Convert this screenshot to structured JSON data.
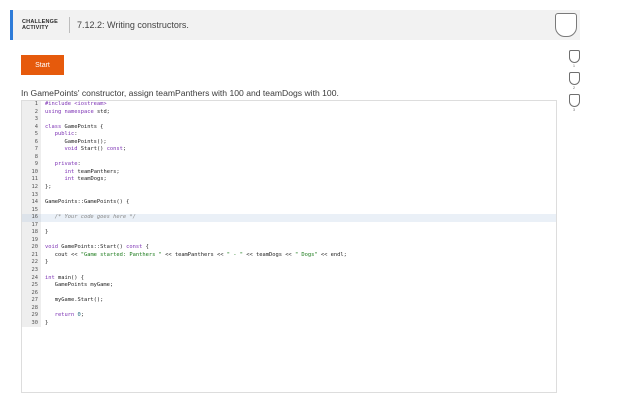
{
  "header": {
    "activity_line1": "CHALLENGE",
    "activity_line2": "ACTIVITY",
    "title": "7.12.2: Writing constructors."
  },
  "start_label": "Start",
  "levels": [
    "1",
    "2",
    "3"
  ],
  "instructions": "In GamePoints' constructor, assign teamPanthers with 100 and teamDogs with 100.",
  "code_lines": [
    "#include <iostream>",
    "using namespace std;",
    "",
    "class GamePoints {",
    "   public:",
    "      GamePoints();",
    "      void Start() const;",
    "",
    "   private:",
    "      int teamPanthers;",
    "      int teamDogs;",
    "};",
    "",
    "GamePoints::GamePoints() {",
    "",
    "   /* Your code goes here */",
    "",
    "}",
    "",
    "void GamePoints::Start() const {",
    "   cout << \"Game started: Panthers \" << teamPanthers << \" - \" << teamDogs << \" Dogs\" << endl;",
    "}",
    "",
    "int main() {",
    "   GamePoints myGame;",
    "",
    "   myGame.Start();",
    "",
    "   return 0;",
    "}"
  ],
  "highlight_line": 16
}
